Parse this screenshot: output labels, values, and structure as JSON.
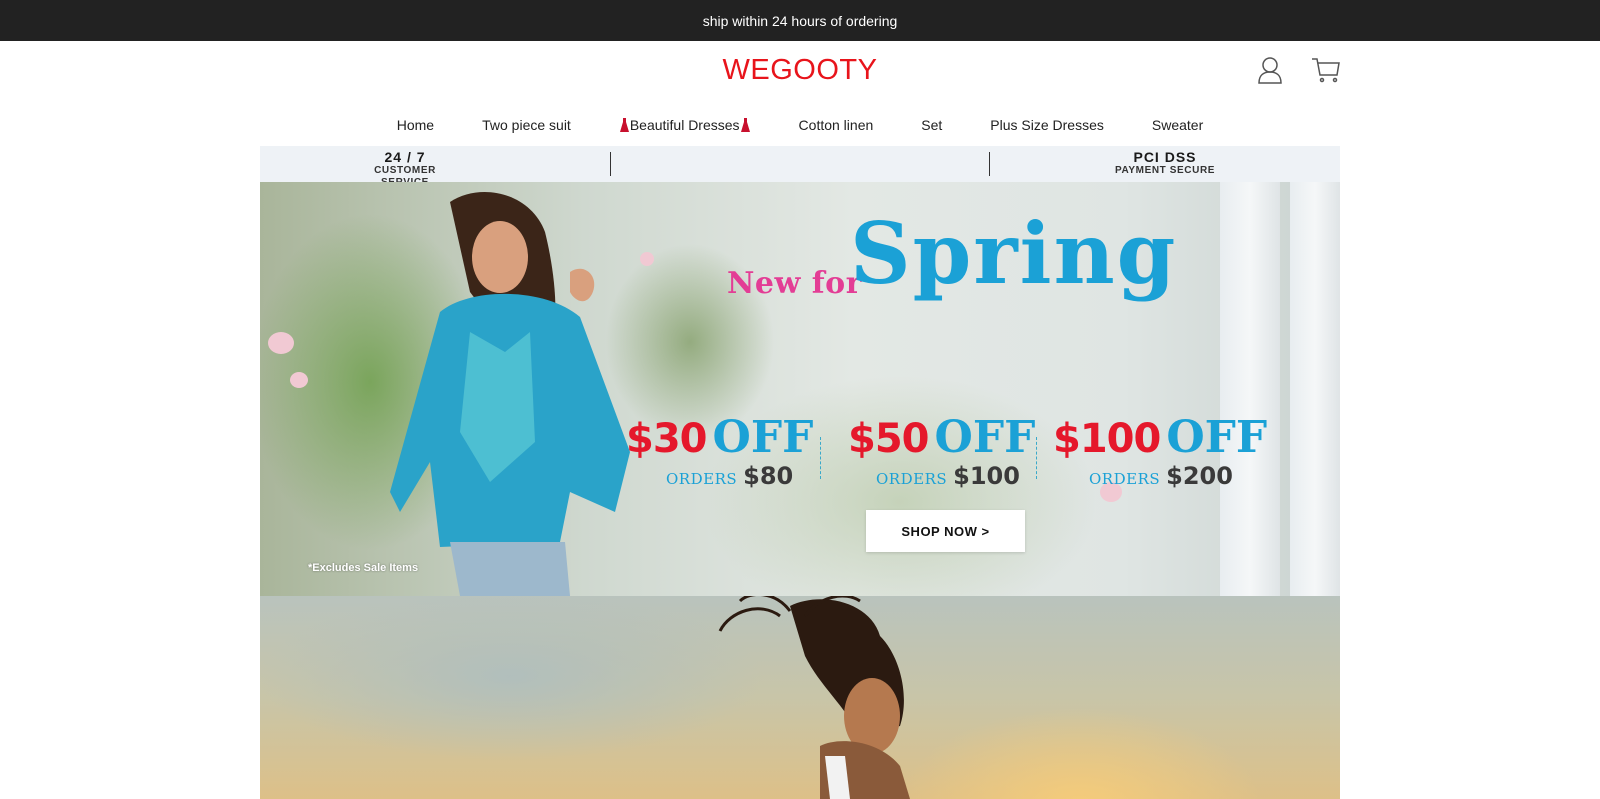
{
  "announcement": "ship within 24 hours of ordering",
  "header": {
    "logo": "WEGOOTY",
    "account_icon": "user-icon",
    "cart_icon": "cart-icon"
  },
  "nav": {
    "items": [
      {
        "label": "Home"
      },
      {
        "label": "Two piece suit"
      },
      {
        "label": "Beautiful Dresses"
      },
      {
        "label": "Cotton linen"
      },
      {
        "label": "Set"
      },
      {
        "label": "Plus Size Dresses"
      },
      {
        "label": "Sweater"
      }
    ]
  },
  "trust_bar": {
    "left_big": "24 / 7",
    "left_small": "CUSTOMER SERVICE",
    "right_big": "PCI DSS",
    "right_small": "PAYMENT SECURE"
  },
  "hero": {
    "headline_small": "New for",
    "headline_big": "Spring",
    "offers": [
      {
        "amount": "$30",
        "off": "OFF",
        "orders_label": "ORDERS",
        "orders_value": "$80"
      },
      {
        "amount": "$50",
        "off": "OFF",
        "orders_label": "ORDERS",
        "orders_value": "$100"
      },
      {
        "amount": "$100",
        "off": "OFF",
        "orders_label": "ORDERS",
        "orders_value": "$200"
      }
    ],
    "cta": "SHOP NOW >",
    "disclaimer": "*Excludes Sale Items"
  },
  "colors": {
    "brand_red": "#e8141b",
    "accent_blue": "#1ba1d6",
    "accent_pink": "#e33d95",
    "topbar": "#222222"
  }
}
